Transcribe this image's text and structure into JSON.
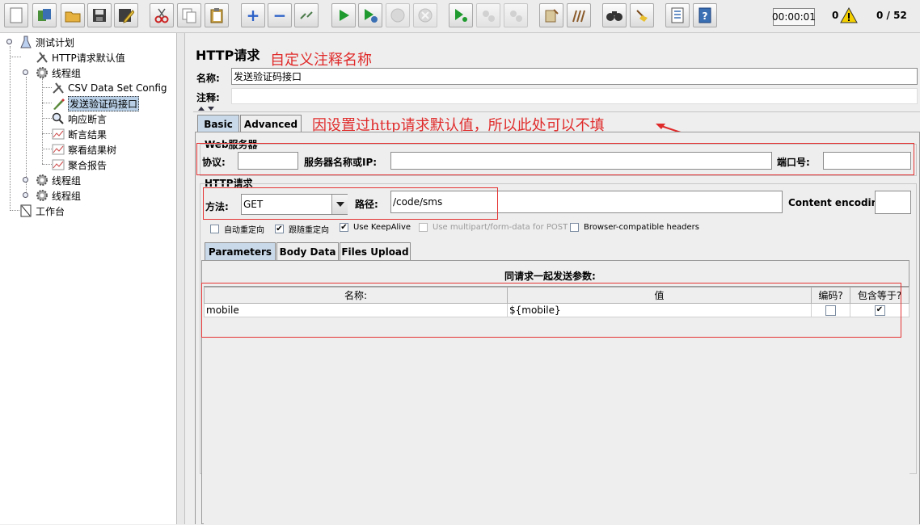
{
  "toolbar": {
    "timer": "00:00:01",
    "error_count": "0",
    "thread_count": "0 / 52"
  },
  "tree": {
    "nodes": [
      {
        "label": "测试计划"
      },
      {
        "label": "HTTP请求默认值"
      },
      {
        "label": "线程组"
      },
      {
        "label": "CSV Data Set Config"
      },
      {
        "label": "发送验证码接口"
      },
      {
        "label": "响应断言"
      },
      {
        "label": "断言结果"
      },
      {
        "label": "察看结果树"
      },
      {
        "label": "聚合报告"
      },
      {
        "label": "线程组"
      },
      {
        "label": "线程组"
      },
      {
        "label": "工作台"
      }
    ]
  },
  "main": {
    "title": "HTTP请求",
    "annotation_note": "自定义注释名称",
    "name_label": "名称:",
    "name_value": "发送验证码接口",
    "comment_label": "注释:",
    "comment_value": "",
    "tabs": [
      {
        "label": "Basic"
      },
      {
        "label": "Advanced"
      }
    ],
    "default_note": "因设置过http请求默认值，所以此处可以不填",
    "web_server": {
      "legend": "Web服务器",
      "protocol_label": "协议:",
      "protocol_value": "",
      "server_label": "服务器名称或IP:",
      "server_value": "",
      "port_label": "端口号:",
      "port_value": ""
    },
    "http_request": {
      "legend": "HTTP请求",
      "method_label": "方法:",
      "method_value": "GET",
      "path_label": "路径:",
      "path_value": "/code/sms",
      "encoding_label": "Content encoding:",
      "encoding_value": ""
    },
    "options": [
      {
        "label": "自动重定向",
        "checked": false,
        "disabled": false
      },
      {
        "label": "跟随重定向",
        "checked": true,
        "disabled": false
      },
      {
        "label": "Use KeepAlive",
        "checked": true,
        "disabled": false
      },
      {
        "label": "Use multipart/form-data for POST",
        "checked": false,
        "disabled": true
      },
      {
        "label": "Browser-compatible headers",
        "checked": false,
        "disabled": false
      }
    ],
    "sub_tabs": [
      {
        "label": "Parameters"
      },
      {
        "label": "Body Data"
      },
      {
        "label": "Files Upload"
      }
    ],
    "params": {
      "title": "同请求一起发送参数:",
      "headers": [
        "名称:",
        "值",
        "编码?",
        "包含等于?"
      ],
      "rows": [
        {
          "name": "mobile",
          "value": "${mobile}",
          "encode": false,
          "include_equals": true
        }
      ]
    }
  }
}
